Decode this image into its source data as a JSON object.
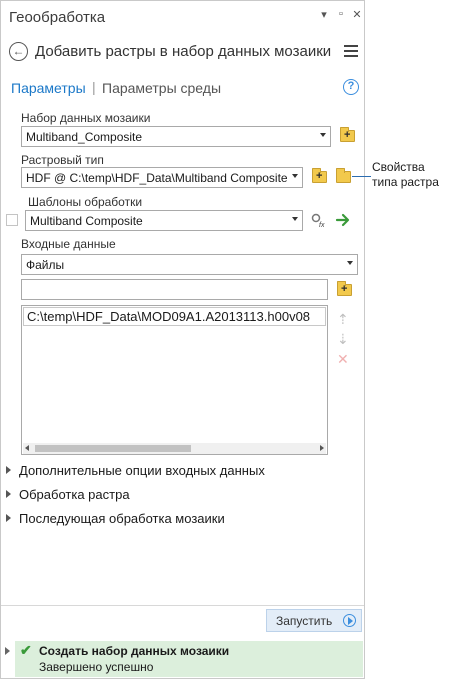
{
  "window": {
    "title": "Геообработка",
    "controls": {
      "pin": "▾",
      "restore": "▫",
      "close": "✕"
    }
  },
  "header": {
    "title": "Добавить растры в набор данных мозаики",
    "back_icon": "back-arrow-icon",
    "menu_icon": "hamburger-menu-icon"
  },
  "tabs": {
    "parameters": "Параметры",
    "separator": "|",
    "environments": "Параметры среды",
    "help": "?"
  },
  "fields": {
    "mosaic_dataset": {
      "label": "Набор данных мозаики",
      "value": "Multiband_Composite"
    },
    "raster_type": {
      "label": "Растровый тип",
      "value": "HDF @ C:\\temp\\HDF_Data\\Multiband Composite"
    },
    "processing_templates": {
      "label": "Шаблоны обработки",
      "value": "Multiband Composite"
    },
    "input_data": {
      "label": "Входные данные",
      "value": "Файлы",
      "path_value": "",
      "files": [
        "C:\\temp\\HDF_Data\\MOD09A1.A2013113.h00v08"
      ]
    }
  },
  "callout": {
    "line1": "Свойства",
    "line2": "типа растра"
  },
  "sections": [
    "Дополнительные опции входных данных",
    "Обработка растра",
    "Последующая обработка мозаики"
  ],
  "footer": {
    "run_label": "Запустить"
  },
  "status": {
    "title": "Создать набор данных мозаики",
    "message": "Завершено успешно",
    "color": "#dcefdc"
  },
  "colors": {
    "accent": "#1b78c8",
    "success": "#3a9a3a"
  }
}
